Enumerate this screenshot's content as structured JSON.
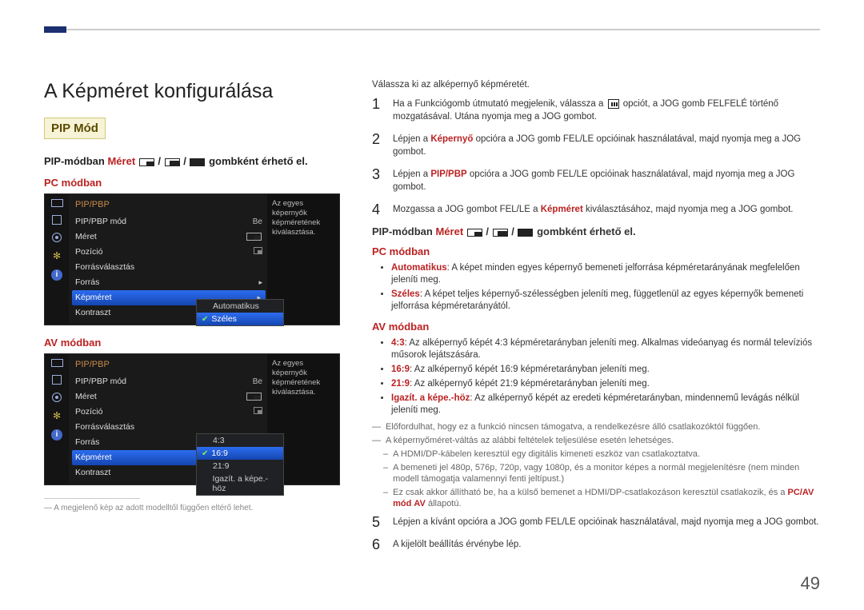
{
  "page_number": "49",
  "title": "A Képméret konfigurálása",
  "pip_mode_label": "PIP Mód",
  "pip_heading_pre": "PIP-módban",
  "pip_heading_red": "Méret",
  "pip_heading_post": "gombként érhető el",
  "pc_mode": "PC módban",
  "av_mode": "AV módban",
  "footnote": "A megjelenő kép az adott modelltől függően eltérő lehet.",
  "osd": {
    "title": "PIP/PBP",
    "desc": "Az egyes képernyők képméretének kiválasztása.",
    "rows": {
      "mode": {
        "label": "PIP/PBP mód",
        "value": "Be"
      },
      "size": {
        "label": "Méret"
      },
      "position": {
        "label": "Pozíció"
      },
      "source_sel": {
        "label": "Forrásválasztás"
      },
      "source": {
        "label": "Forrás"
      },
      "picsize": {
        "label": "Képméret"
      },
      "contrast": {
        "label": "Kontraszt"
      }
    },
    "submenu_pc": {
      "auto": "Automatikus",
      "wide": "Széles"
    },
    "submenu_av": {
      "r43": "4:3",
      "r169": "16:9",
      "r219": "21:9",
      "fit": "Igazít. a képe.-höz"
    }
  },
  "right": {
    "intro": "Válassza ki az alképernyő képméretét.",
    "step1_pre": "Ha a Funkciógomb útmutató megjelenik, válassza a ",
    "step1_post": " opciót, a JOG gomb FELFELÉ történő mozgatásával. Utána nyomja meg a JOG gombot.",
    "step2_pre": "Lépjen a ",
    "step2_bold": "Képernyő",
    "step2_post": " opcióra a JOG gomb FEL/LE opcióinak használatával, majd nyomja meg a JOG gombot.",
    "step3_pre": "Lépjen a ",
    "step3_bold": "PIP/PBP",
    "step3_post": " opcióra a JOG gomb FEL/LE opcióinak használatával, majd nyomja meg a JOG gombot.",
    "step4_pre": "Mozgassa a JOG gombot FEL/LE a ",
    "step4_bold": "Képméret",
    "step4_post": " kiválasztásához, majd nyomja meg a JOG gombot.",
    "bullets_pc": {
      "auto_b": "Automatikus",
      "auto_t": ": A képet minden egyes képernyő bemeneti jelforrása képméretarányának megfelelően jeleníti meg.",
      "wide_b": "Széles",
      "wide_t": ": A képet teljes képernyő-szélességben jeleníti meg, függetlenül az egyes képernyők bemeneti jelforrása képméretarányától."
    },
    "bullets_av": {
      "r43_b": "4:3",
      "r43_t": ": Az alképernyő képét 4:3 képméretarányban jeleníti meg. Alkalmas videóanyag és normál televíziós műsorok lejátszására.",
      "r169_b": "16:9",
      "r169_t": ": Az alképernyő képét 16:9 képméretarányban jeleníti meg.",
      "r219_b": "21:9",
      "r219_t": ": Az alképernyő képét 21:9 képméretarányban jeleníti meg.",
      "fit_b": "Igazít. a képe.-höz",
      "fit_t": ": Az alképernyő képét az eredeti képméretarányban, mindennemű levágás nélkül jeleníti meg."
    },
    "notes": {
      "n1": "Előfordulhat, hogy ez a funkció nincsen támogatva, a rendelkezésre álló csatlakozóktól függően.",
      "n2": "A képernyőméret-váltás az alábbi feltételek teljesülése esetén lehetséges.",
      "n2a": "A HDMI/DP-kábelen keresztül egy digitális kimeneti eszköz van csatlakoztatva.",
      "n2b": "A bemeneti jel 480p, 576p, 720p, vagy 1080p, és a monitor képes a normál megjelenítésre (nem minden modell támogatja valamennyi fenti jeltípust.)",
      "n2c_pre": "Ez csak akkor állítható be, ha a külső bemenet a HDMI/DP-csatlakozáson keresztül csatlakozik, és a ",
      "n2c_bold1": "PC/AV mód",
      "n2c_bold2": "AV",
      "n2c_post": " állapotú."
    },
    "step5": "Lépjen a kívánt opcióra a JOG gomb FEL/LE opcióinak használatával, majd nyomja meg a JOG gombot.",
    "step6": "A kijelölt beállítás érvénybe lép."
  }
}
